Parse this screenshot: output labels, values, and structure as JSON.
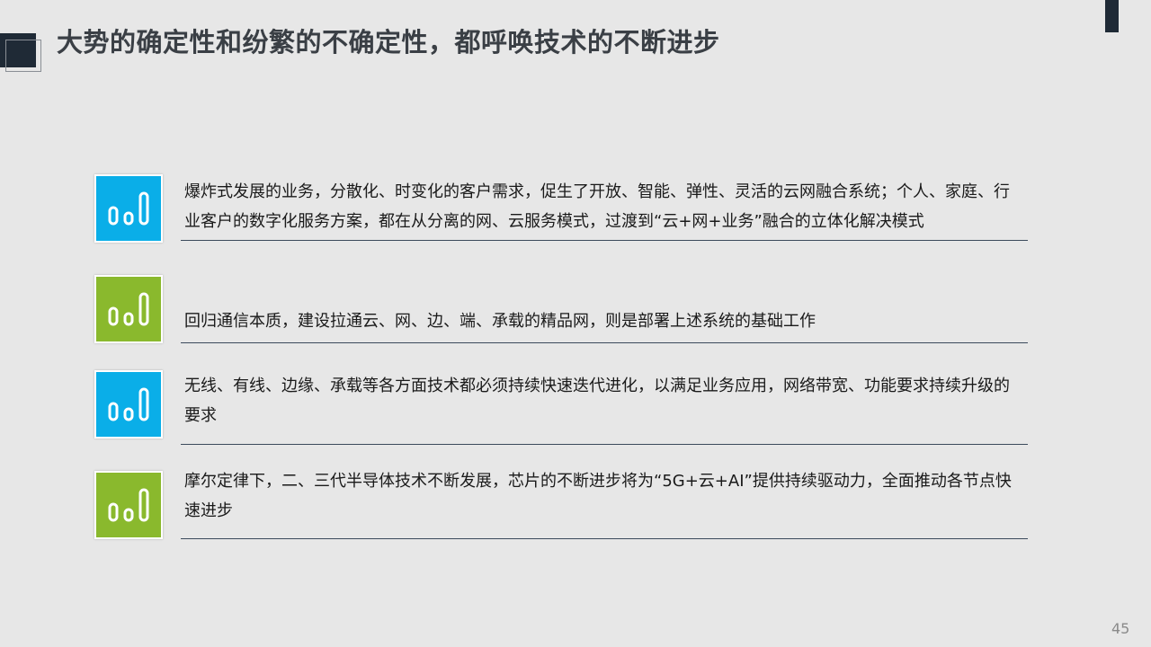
{
  "title": "大势的确定性和纷繁的不确定性，都呼唤技术的不断进步",
  "page_number": "45",
  "colors": {
    "blue": "#0aaee8",
    "green": "#8ab92d",
    "dark": "#1f2a36"
  },
  "rows": [
    {
      "icon": "bar-chart-icon",
      "color": "blue",
      "text": "爆炸式发展的业务，分散化、时变化的客户需求，促生了开放、智能、弹性、灵活的云网融合系统；个人、家庭、行业客户的数字化服务方案，都在从分离的网、云服务模式，过渡到“云+网+业务”融合的立体化解决模式"
    },
    {
      "icon": "bar-chart-icon",
      "color": "green",
      "text": "回归通信本质，建设拉通云、网、边、端、承载的精品网，则是部署上述系统的基础工作"
    },
    {
      "icon": "bar-chart-icon",
      "color": "blue",
      "text": "无线、有线、边缘、承载等各方面技术都必须持续快速迭代进化，以满足业务应用，网络带宽、功能要求持续升级的要求"
    },
    {
      "icon": "bar-chart-icon",
      "color": "green",
      "text": "摩尔定律下，二、三代半导体技术不断发展，芯片的不断进步将为“5G+云+AI”提供持续驱动力，全面推动各节点快速进步"
    }
  ]
}
